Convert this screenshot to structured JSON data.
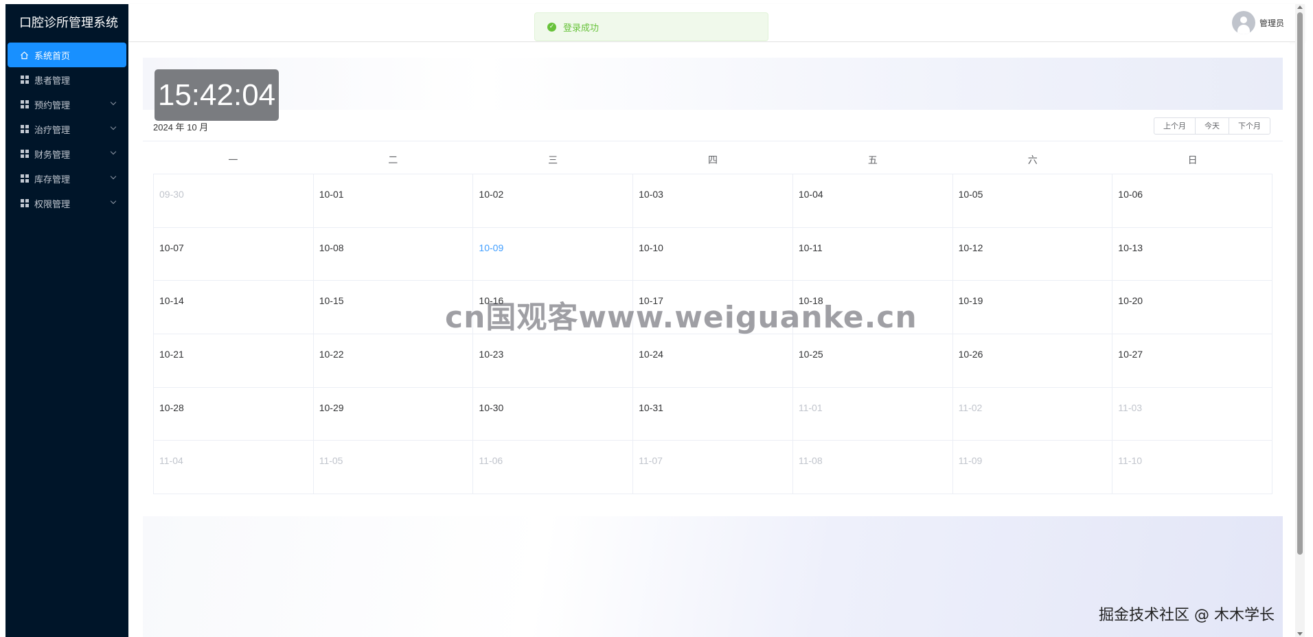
{
  "sidebar": {
    "title": "口腔诊所管理系统",
    "items": [
      {
        "label": "系统首页",
        "icon": "home-icon",
        "active": true,
        "expandable": false
      },
      {
        "label": "患者管理",
        "icon": "grid-icon",
        "active": false,
        "expandable": false
      },
      {
        "label": "预约管理",
        "icon": "grid-icon",
        "active": false,
        "expandable": true
      },
      {
        "label": "治疗管理",
        "icon": "grid-icon",
        "active": false,
        "expandable": true
      },
      {
        "label": "财务管理",
        "icon": "grid-icon",
        "active": false,
        "expandable": true
      },
      {
        "label": "库存管理",
        "icon": "grid-icon",
        "active": false,
        "expandable": true
      },
      {
        "label": "权限管理",
        "icon": "grid-icon",
        "active": false,
        "expandable": true
      }
    ]
  },
  "header": {
    "toast": "登录成功",
    "user_name": "管理员"
  },
  "clock": "15:42:04",
  "calendar": {
    "title": "2024 年 10 月",
    "buttons": {
      "prev": "上个月",
      "today": "今天",
      "next": "下个月"
    },
    "weekdays": [
      "一",
      "二",
      "三",
      "四",
      "五",
      "六",
      "日"
    ],
    "today": "10-09",
    "days": [
      {
        "d": "09-30",
        "other": true
      },
      {
        "d": "10-01"
      },
      {
        "d": "10-02"
      },
      {
        "d": "10-03"
      },
      {
        "d": "10-04"
      },
      {
        "d": "10-05"
      },
      {
        "d": "10-06"
      },
      {
        "d": "10-07"
      },
      {
        "d": "10-08"
      },
      {
        "d": "10-09",
        "today": true
      },
      {
        "d": "10-10"
      },
      {
        "d": "10-11"
      },
      {
        "d": "10-12"
      },
      {
        "d": "10-13"
      },
      {
        "d": "10-14"
      },
      {
        "d": "10-15"
      },
      {
        "d": "10-16"
      },
      {
        "d": "10-17"
      },
      {
        "d": "10-18"
      },
      {
        "d": "10-19"
      },
      {
        "d": "10-20"
      },
      {
        "d": "10-21"
      },
      {
        "d": "10-22"
      },
      {
        "d": "10-23"
      },
      {
        "d": "10-24"
      },
      {
        "d": "10-25"
      },
      {
        "d": "10-26"
      },
      {
        "d": "10-27"
      },
      {
        "d": "10-28"
      },
      {
        "d": "10-29"
      },
      {
        "d": "10-30"
      },
      {
        "d": "10-31"
      },
      {
        "d": "11-01",
        "other": true
      },
      {
        "d": "11-02",
        "other": true
      },
      {
        "d": "11-03",
        "other": true
      },
      {
        "d": "11-04",
        "other": true
      },
      {
        "d": "11-05",
        "other": true
      },
      {
        "d": "11-06",
        "other": true
      },
      {
        "d": "11-07",
        "other": true
      },
      {
        "d": "11-08",
        "other": true
      },
      {
        "d": "11-09",
        "other": true
      },
      {
        "d": "11-10",
        "other": true
      }
    ]
  },
  "watermark": "cn国观客www.weiguanke.cn",
  "corner_mark": "掘金技术社区 @ 木木学长",
  "colors": {
    "sidebar_bg": "#001529",
    "active": "#1890ff",
    "today": "#409eff",
    "success": "#67c23a"
  }
}
